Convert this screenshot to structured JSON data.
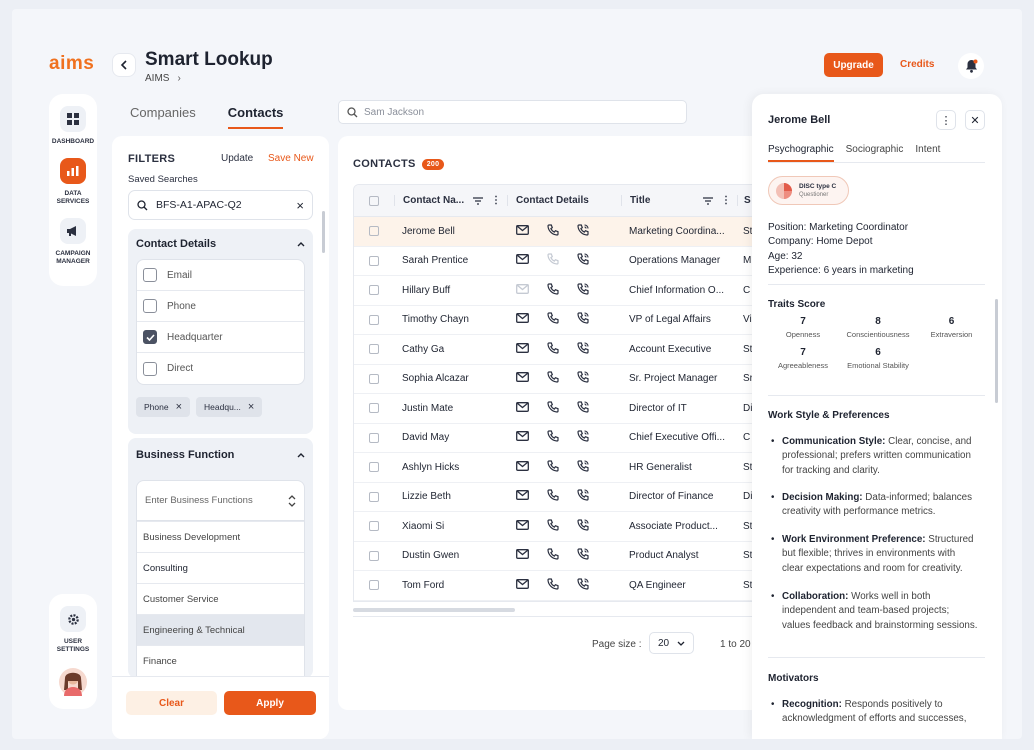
{
  "brand": {
    "logo": "aims",
    "accent": "#e8581a"
  },
  "nav": {
    "dashboard": "DASHBOARD",
    "data_services": "DATA SERVICES",
    "campaign_manager": "CAMPAIGN MANAGER",
    "user_settings": "USER SETTINGS"
  },
  "header": {
    "title": "Smart Lookup",
    "breadcrumb": "AIMS",
    "upgrade": "Upgrade",
    "credits": "Credits"
  },
  "tabs": {
    "companies": "Companies",
    "contacts": "Contacts"
  },
  "search": {
    "placeholder": "Sam Jackson"
  },
  "filters": {
    "title": "FILTERS",
    "update": "Update",
    "save_new": "Save New",
    "saved_label": "Saved Searches",
    "saved_value": "BFS-A1-APAC-Q2",
    "contact_details": {
      "title": "Contact Details",
      "options": [
        {
          "label": "Email",
          "checked": false
        },
        {
          "label": "Phone",
          "checked": false
        },
        {
          "label": "Headquarter",
          "checked": true
        },
        {
          "label": "Direct",
          "checked": false
        }
      ],
      "chips": [
        "Phone",
        "Headqu..."
      ]
    },
    "business_function": {
      "title": "Business Function",
      "placeholder": "Enter Business Functions",
      "options": [
        "Business Development",
        "Consulting",
        "Customer Service",
        "Engineering & Technical",
        "Finance"
      ]
    },
    "clear": "Clear",
    "apply": "Apply"
  },
  "contacts": {
    "title": "CONTACTS",
    "count": "200",
    "columns": {
      "name": "Contact Na...",
      "details": "Contact Details",
      "title": "Title",
      "s": "S"
    },
    "rows": [
      {
        "name": "Jerome Bell",
        "title": "Marketing Coordina...",
        "s": "St"
      },
      {
        "name": "Sarah Prentice",
        "title": "Operations Manager",
        "s": "M"
      },
      {
        "name": "Hillary Buff",
        "title": "Chief Information O...",
        "s": "C"
      },
      {
        "name": "Timothy Chayn",
        "title": "VP of Legal Affairs",
        "s": "Vi"
      },
      {
        "name": "Cathy Ga",
        "title": "Account Executive",
        "s": "St"
      },
      {
        "name": " Sophia Alcazar",
        "title": "Sr. Project Manager",
        "s": "Sr"
      },
      {
        "name": "Justin Mate",
        "title": "Director of IT",
        "s": "Di"
      },
      {
        "name": "David May",
        "title": "Chief Executive Offi...",
        "s": "C"
      },
      {
        "name": "Ashlyn Hicks",
        "title": "HR Generalist",
        "s": "St"
      },
      {
        "name": "Lizzie Beth",
        "title": "Director of Finance",
        "s": "Di"
      },
      {
        "name": "Xiaomi Si",
        "title": "Associate Product...",
        "s": "St"
      },
      {
        "name": "Dustin Gwen",
        "title": "Product Analyst",
        "s": "St"
      },
      {
        "name": "Tom Ford",
        "title": "QA Engineer",
        "s": "St"
      }
    ],
    "page_size_label": "Page size :",
    "page_size": "20",
    "range": "1 to 20"
  },
  "details": {
    "name": "Jerome Bell",
    "tabs": [
      "Psychographic",
      "Sociographic",
      "Intent"
    ],
    "disc_type": "DISC type C",
    "disc_label": "Questioner",
    "position": "Position: Marketing Coordinator",
    "company": "Company: Home Depot",
    "age": "Age: 32",
    "experience": "Experience: 6 years in marketing",
    "traits_title": "Traits Score",
    "traits": [
      {
        "value": "7",
        "label": "Openness"
      },
      {
        "value": "8",
        "label": "Conscientiousness"
      },
      {
        "value": "6",
        "label": "Extraversion"
      },
      {
        "value": "7",
        "label": "Agreeableness"
      },
      {
        "value": "6",
        "label": "Emotional Stability"
      }
    ],
    "workstyle_title": "Work Style & Preferences",
    "workstyle": [
      {
        "k": "Communication Style:",
        "v": " Clear, concise, and professional; prefers written communication for tracking and clarity."
      },
      {
        "k": "Decision Making:",
        "v": " Data-informed; balances creativity with performance metrics."
      },
      {
        "k": "Work Environment Preference:",
        "v": " Structured but flexible; thrives in environments with clear expectations and room for creativity."
      },
      {
        "k": "Collaboration:",
        "v": " Works well in both independent and team-based projects; values feedback and brainstorming sessions."
      }
    ],
    "motivators_title": "Motivators",
    "motivators": [
      {
        "k": "Recognition:",
        "v": " Responds positively to acknowledgment of efforts and successes,"
      }
    ]
  }
}
